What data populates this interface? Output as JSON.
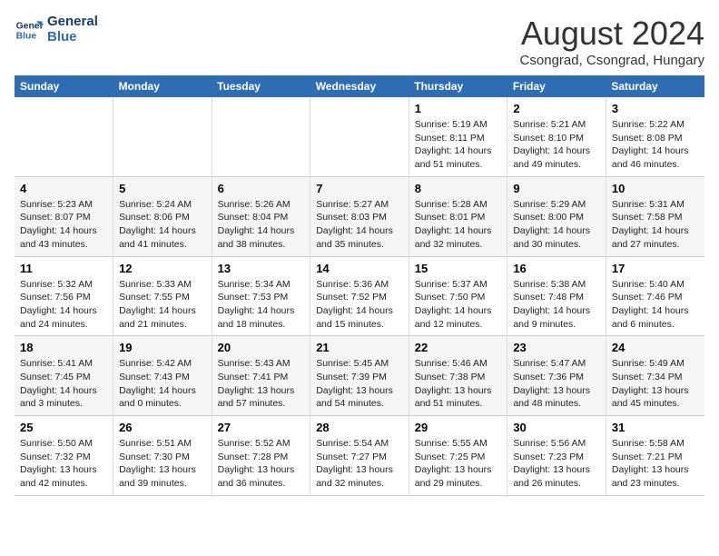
{
  "header": {
    "logo_line1": "General",
    "logo_line2": "Blue",
    "month_year": "August 2024",
    "location": "Csongrad, Csongrad, Hungary"
  },
  "weekdays": [
    "Sunday",
    "Monday",
    "Tuesday",
    "Wednesday",
    "Thursday",
    "Friday",
    "Saturday"
  ],
  "weeks": [
    [
      {
        "day": "",
        "text": ""
      },
      {
        "day": "",
        "text": ""
      },
      {
        "day": "",
        "text": ""
      },
      {
        "day": "",
        "text": ""
      },
      {
        "day": "1",
        "text": "Sunrise: 5:19 AM\nSunset: 8:11 PM\nDaylight: 14 hours and 51 minutes."
      },
      {
        "day": "2",
        "text": "Sunrise: 5:21 AM\nSunset: 8:10 PM\nDaylight: 14 hours and 49 minutes."
      },
      {
        "day": "3",
        "text": "Sunrise: 5:22 AM\nSunset: 8:08 PM\nDaylight: 14 hours and 46 minutes."
      }
    ],
    [
      {
        "day": "4",
        "text": "Sunrise: 5:23 AM\nSunset: 8:07 PM\nDaylight: 14 hours and 43 minutes."
      },
      {
        "day": "5",
        "text": "Sunrise: 5:24 AM\nSunset: 8:06 PM\nDaylight: 14 hours and 41 minutes."
      },
      {
        "day": "6",
        "text": "Sunrise: 5:26 AM\nSunset: 8:04 PM\nDaylight: 14 hours and 38 minutes."
      },
      {
        "day": "7",
        "text": "Sunrise: 5:27 AM\nSunset: 8:03 PM\nDaylight: 14 hours and 35 minutes."
      },
      {
        "day": "8",
        "text": "Sunrise: 5:28 AM\nSunset: 8:01 PM\nDaylight: 14 hours and 32 minutes."
      },
      {
        "day": "9",
        "text": "Sunrise: 5:29 AM\nSunset: 8:00 PM\nDaylight: 14 hours and 30 minutes."
      },
      {
        "day": "10",
        "text": "Sunrise: 5:31 AM\nSunset: 7:58 PM\nDaylight: 14 hours and 27 minutes."
      }
    ],
    [
      {
        "day": "11",
        "text": "Sunrise: 5:32 AM\nSunset: 7:56 PM\nDaylight: 14 hours and 24 minutes."
      },
      {
        "day": "12",
        "text": "Sunrise: 5:33 AM\nSunset: 7:55 PM\nDaylight: 14 hours and 21 minutes."
      },
      {
        "day": "13",
        "text": "Sunrise: 5:34 AM\nSunset: 7:53 PM\nDaylight: 14 hours and 18 minutes."
      },
      {
        "day": "14",
        "text": "Sunrise: 5:36 AM\nSunset: 7:52 PM\nDaylight: 14 hours and 15 minutes."
      },
      {
        "day": "15",
        "text": "Sunrise: 5:37 AM\nSunset: 7:50 PM\nDaylight: 14 hours and 12 minutes."
      },
      {
        "day": "16",
        "text": "Sunrise: 5:38 AM\nSunset: 7:48 PM\nDaylight: 14 hours and 9 minutes."
      },
      {
        "day": "17",
        "text": "Sunrise: 5:40 AM\nSunset: 7:46 PM\nDaylight: 14 hours and 6 minutes."
      }
    ],
    [
      {
        "day": "18",
        "text": "Sunrise: 5:41 AM\nSunset: 7:45 PM\nDaylight: 14 hours and 3 minutes."
      },
      {
        "day": "19",
        "text": "Sunrise: 5:42 AM\nSunset: 7:43 PM\nDaylight: 14 hours and 0 minutes."
      },
      {
        "day": "20",
        "text": "Sunrise: 5:43 AM\nSunset: 7:41 PM\nDaylight: 13 hours and 57 minutes."
      },
      {
        "day": "21",
        "text": "Sunrise: 5:45 AM\nSunset: 7:39 PM\nDaylight: 13 hours and 54 minutes."
      },
      {
        "day": "22",
        "text": "Sunrise: 5:46 AM\nSunset: 7:38 PM\nDaylight: 13 hours and 51 minutes."
      },
      {
        "day": "23",
        "text": "Sunrise: 5:47 AM\nSunset: 7:36 PM\nDaylight: 13 hours and 48 minutes."
      },
      {
        "day": "24",
        "text": "Sunrise: 5:49 AM\nSunset: 7:34 PM\nDaylight: 13 hours and 45 minutes."
      }
    ],
    [
      {
        "day": "25",
        "text": "Sunrise: 5:50 AM\nSunset: 7:32 PM\nDaylight: 13 hours and 42 minutes."
      },
      {
        "day": "26",
        "text": "Sunrise: 5:51 AM\nSunset: 7:30 PM\nDaylight: 13 hours and 39 minutes."
      },
      {
        "day": "27",
        "text": "Sunrise: 5:52 AM\nSunset: 7:28 PM\nDaylight: 13 hours and 36 minutes."
      },
      {
        "day": "28",
        "text": "Sunrise: 5:54 AM\nSunset: 7:27 PM\nDaylight: 13 hours and 32 minutes."
      },
      {
        "day": "29",
        "text": "Sunrise: 5:55 AM\nSunset: 7:25 PM\nDaylight: 13 hours and 29 minutes."
      },
      {
        "day": "30",
        "text": "Sunrise: 5:56 AM\nSunset: 7:23 PM\nDaylight: 13 hours and 26 minutes."
      },
      {
        "day": "31",
        "text": "Sunrise: 5:58 AM\nSunset: 7:21 PM\nDaylight: 13 hours and 23 minutes."
      }
    ]
  ]
}
